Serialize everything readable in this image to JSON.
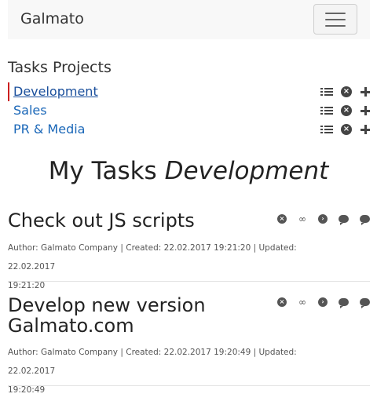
{
  "app": {
    "brand": "Galmato"
  },
  "projects": {
    "title": "Tasks Projects",
    "items": [
      {
        "label": "Development",
        "active": true
      },
      {
        "label": "Sales",
        "active": false
      },
      {
        "label": "PR & Media",
        "active": false
      }
    ]
  },
  "page": {
    "heading_prefix": "My Tasks",
    "heading_project": "Development"
  },
  "tasks": [
    {
      "title": "Check out JS scripts",
      "meta_line1": "Author: Galmato Company | Created: 22.02.2017 19:21:20 | Updated: 22.02.2017",
      "meta_line2": "19:21:20"
    },
    {
      "title_line1": "Develop new version",
      "title_line2": "Galmato.com",
      "meta_line1": "Author: Galmato Company | Created: 22.02.2017 19:20:49 | Updated: 22.02.2017",
      "meta_line2": "19:20:49"
    }
  ],
  "colors": {
    "active_marker": "#cc1f1f",
    "link": "#1a67b8",
    "navbar_bg": "#f8f8f8"
  },
  "icons": [
    "list-icon",
    "remove-icon",
    "add-icon",
    "link-icon",
    "arrow-right-icon",
    "comments-icon",
    "comment-icon"
  ]
}
